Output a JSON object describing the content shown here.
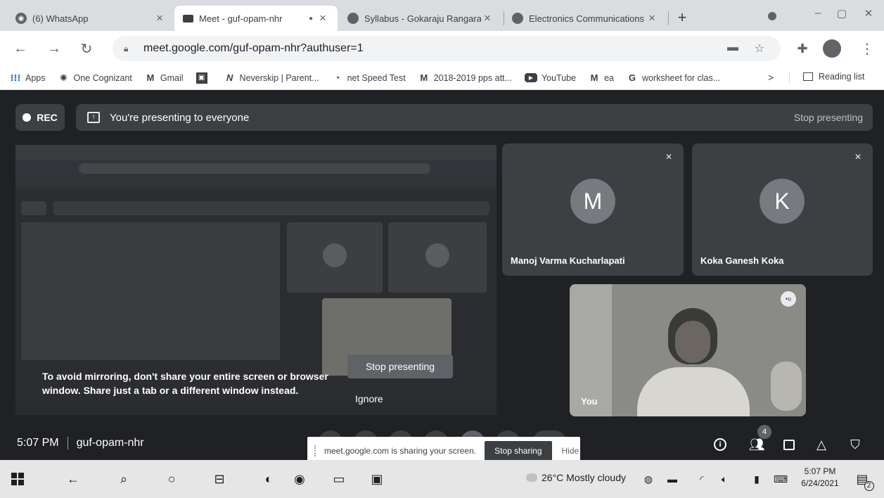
{
  "browser": {
    "tabs": [
      {
        "title": "(6) WhatsApp",
        "close": "×"
      },
      {
        "title": "Meet - guf-opam-nhr",
        "recording_dot": "●",
        "close": "×"
      },
      {
        "title": "Syllabus - Gokaraju Rangaraju I",
        "close": "×"
      },
      {
        "title": "Electronics Communications Er",
        "close": "×"
      }
    ],
    "new_tab": "+",
    "window_controls": [
      "–",
      "▢",
      "✕"
    ],
    "url": "meet.google.com/guf-opam-nhr?authuser=1",
    "bookmarks": [
      {
        "label": "Apps",
        "icon": "apps-grid-icon"
      },
      {
        "label": "One Cognizant",
        "icon": "cognizant-icon"
      },
      {
        "label": "Gmail",
        "icon": "gmail-icon"
      },
      {
        "label": "",
        "icon": "classroom-icon"
      },
      {
        "label": "Neverskip | Parent...",
        "icon": "neverskip-icon"
      },
      {
        "label": "net Speed Test",
        "icon": "speedometer-icon"
      },
      {
        "label": "2018-2019 pps att...",
        "icon": "gmail-icon"
      },
      {
        "label": "YouTube",
        "icon": "youtube-icon"
      },
      {
        "label": "ea",
        "icon": "gmail-icon"
      },
      {
        "label": "worksheet for clas...",
        "icon": "google-icon"
      }
    ],
    "bookmarks_more": ">",
    "reading_list": "Reading list"
  },
  "meet": {
    "rec_label": "REC",
    "presenting_text": "You're presenting to everyone",
    "stop_presenting_top": "Stop presenting",
    "mirror_warning": "To avoid mirroring, don't share your entire screen or browser window. Share just a tab or a different window instead.",
    "stop_presenting_button": "Stop presenting",
    "ignore_label": "Ignore",
    "participants": [
      {
        "initial": "M",
        "name": "Manoj Varma Kucharlapati"
      },
      {
        "initial": "K",
        "name": "Koka Ganesh Koka"
      }
    ],
    "self_label": "You",
    "time": "5:07 PM",
    "meeting_code": "guf-opam-nhr",
    "share_notice": "meet.google.com is sharing your screen.",
    "stop_sharing": "Stop sharing",
    "hide": "Hide",
    "people_count": "4"
  },
  "taskbar": {
    "weather": "26°C  Mostly cloudy",
    "time": "5:07 PM",
    "date": "6/24/2021",
    "notifications": "2"
  }
}
